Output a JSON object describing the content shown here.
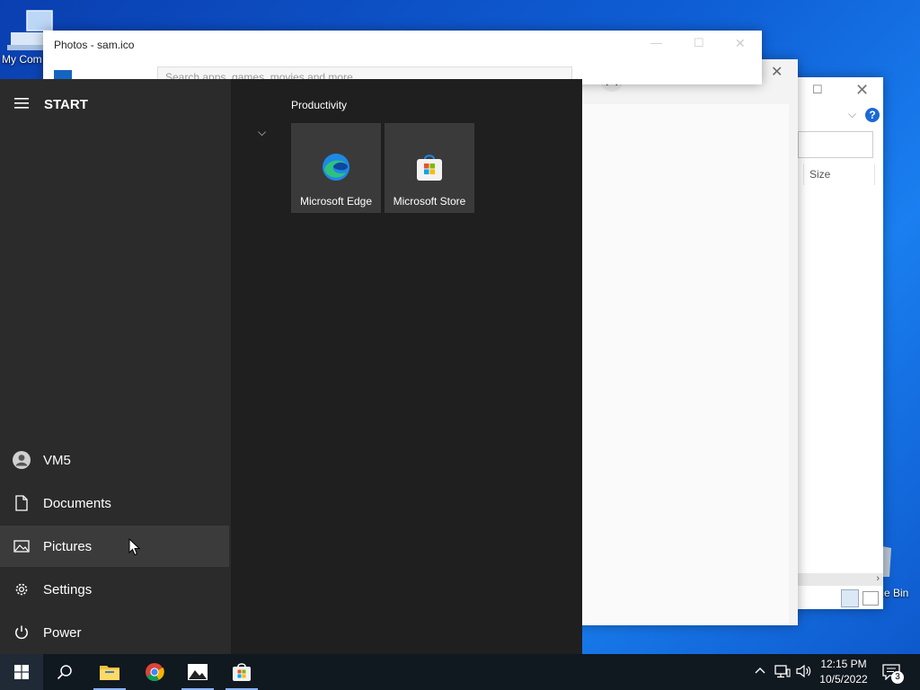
{
  "desktop": {
    "my_computer_label": "My Com",
    "recycle_bin_label": "e Bin"
  },
  "photos_window": {
    "title": "Photos - sam.ico",
    "search_placeholder": "Search apps, games, movies and more"
  },
  "explorer_window": {
    "column_size": "Size",
    "help": "?"
  },
  "start_menu": {
    "header": "START",
    "group_title": "Productivity",
    "tiles": [
      {
        "label": "Microsoft Edge"
      },
      {
        "label": "Microsoft Store"
      }
    ],
    "left_items": [
      {
        "label": "VM5",
        "icon": "user-icon"
      },
      {
        "label": "Documents",
        "icon": "document-icon"
      },
      {
        "label": "Pictures",
        "icon": "pictures-icon"
      },
      {
        "label": "Settings",
        "icon": "gear-icon"
      },
      {
        "label": "Power",
        "icon": "power-icon"
      }
    ]
  },
  "taskbar": {
    "time": "12:15 PM",
    "date": "10/5/2022",
    "notification_count": "3"
  }
}
